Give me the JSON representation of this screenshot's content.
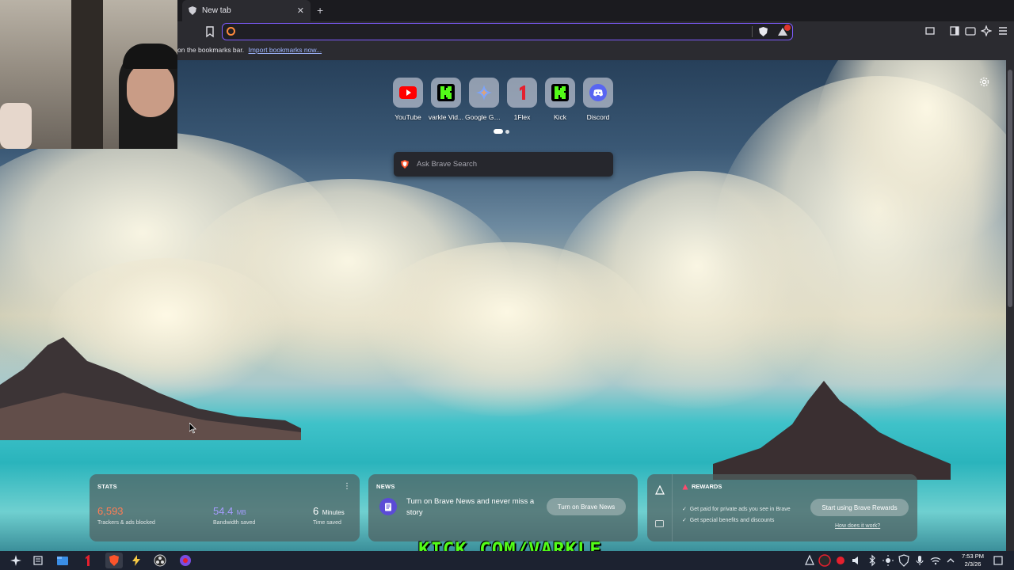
{
  "browser": {
    "tab_title": "New tab",
    "tab_close": "✕",
    "new_tab": "+",
    "omnibox_value": "",
    "bookmarks_prompt": "on the bookmarks bar.",
    "bookmarks_link": "Import bookmarks now..."
  },
  "top_sites": [
    {
      "label": "YouTube",
      "icon": "youtube-icon"
    },
    {
      "label": "varkle Vid...",
      "icon": "kick-icon"
    },
    {
      "label": "Google Ge...",
      "icon": "gemini-icon"
    },
    {
      "label": "1Flex",
      "icon": "oneflex-icon"
    },
    {
      "label": "Kick",
      "icon": "kick-icon"
    },
    {
      "label": "Discord",
      "icon": "discord-icon"
    }
  ],
  "search": {
    "placeholder": "Ask Brave Search"
  },
  "stats": {
    "title": "STATS",
    "trackers_value": "6,593",
    "trackers_label": "Trackers & ads blocked",
    "bandwidth_value": "54.4",
    "bandwidth_unit": "MB",
    "bandwidth_label": "Bandwidth saved",
    "time_value": "6",
    "time_unit": "Minutes",
    "time_label": "Time saved",
    "menu": "⋮"
  },
  "news": {
    "title": "NEWS",
    "text": "Turn on Brave News and never miss a story",
    "button": "Turn on Brave News"
  },
  "rewards": {
    "title": "REWARDS",
    "item1": "Get paid for private ads you see in Brave",
    "item2": "Get special benefits and discounts",
    "button": "Start using Brave Rewards",
    "link": "How does it work?"
  },
  "taskbar": {
    "time": "7:53 PM",
    "date": "2/3/26"
  },
  "overlay": {
    "kick_text": "KICK.COM/VARKLE"
  },
  "colors": {
    "accent": "#7f5cff",
    "trackers": "#ff7d54",
    "bandwidth": "#a59cff",
    "kick_green": "#53fc18",
    "brave_orange": "#fb542b"
  }
}
